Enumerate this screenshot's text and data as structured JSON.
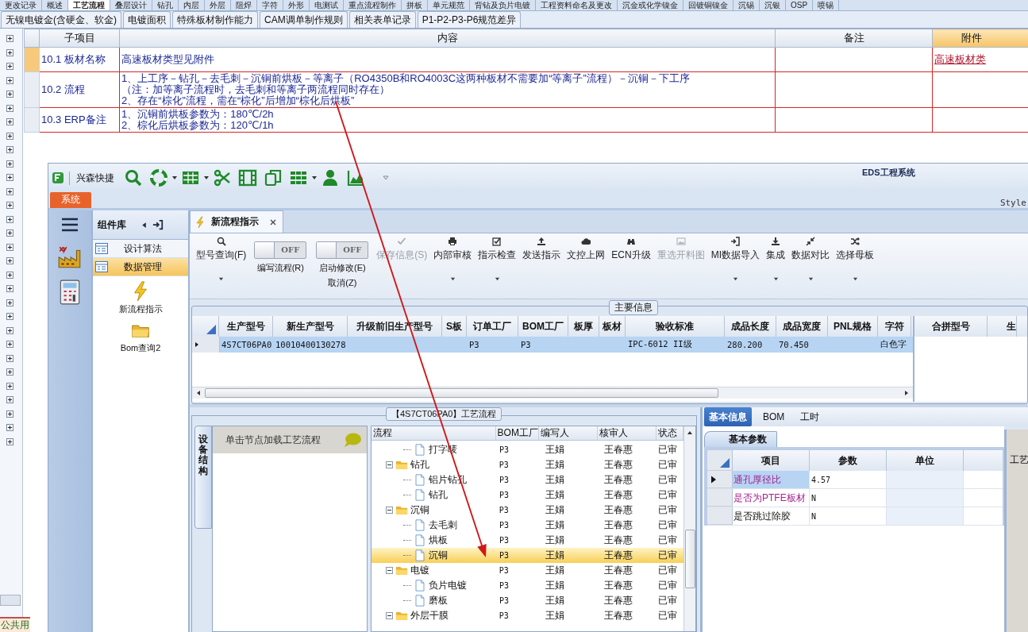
{
  "top_tabs": [
    {
      "label": "更改记录",
      "selected": false
    },
    {
      "label": "概述",
      "selected": false
    },
    {
      "label": "工艺流程",
      "selected": true
    },
    {
      "label": "叠层设计",
      "selected": false
    },
    {
      "label": "钻孔",
      "selected": false
    },
    {
      "label": "内层",
      "selected": false
    },
    {
      "label": "外层",
      "selected": false
    },
    {
      "label": "阻焊",
      "selected": false
    },
    {
      "label": "字符",
      "selected": false
    },
    {
      "label": "外形",
      "selected": false
    },
    {
      "label": "电测试",
      "selected": false
    },
    {
      "label": "重点流程制作",
      "selected": false
    },
    {
      "label": "拼板",
      "selected": false
    },
    {
      "label": "单元规范",
      "selected": false
    },
    {
      "label": "背钻及负片电镀",
      "selected": false
    },
    {
      "label": "工程资料命名及更改",
      "selected": false
    },
    {
      "label": "沉金或化学镍金",
      "selected": false
    },
    {
      "label": "回镀铜镍金",
      "selected": false
    },
    {
      "label": "沉锡",
      "selected": false
    },
    {
      "label": "沉银",
      "selected": false
    },
    {
      "label": "OSP",
      "selected": false
    },
    {
      "label": "喷锡",
      "selected": false
    }
  ],
  "sub_tabs": [
    {
      "label": "无镍电镀金(含硬金、软金)",
      "selected": false
    },
    {
      "label": "电镀面积",
      "selected": false
    },
    {
      "label": "特殊板材制作能力",
      "selected": false
    },
    {
      "label": "CAM调单制作规则",
      "selected": false
    },
    {
      "label": "相关表单记录",
      "selected": false
    },
    {
      "label": "P1-P2-P3-P6规范差异",
      "selected": false
    }
  ],
  "row_toggles": [
    {
      "expanded": false
    },
    {
      "expanded": false
    },
    {
      "expanded": false
    },
    {
      "expanded": false
    },
    {
      "expanded": false
    },
    {
      "expanded": false
    },
    {
      "expanded": false
    },
    {
      "expanded": false
    },
    {
      "expanded": false
    },
    {
      "expanded": false
    },
    {
      "expanded": false
    },
    {
      "expanded": false
    },
    {
      "expanded": false
    },
    {
      "expanded": false
    },
    {
      "expanded": false
    },
    {
      "expanded": false
    },
    {
      "expanded": false
    },
    {
      "expanded": false
    },
    {
      "expanded": false
    },
    {
      "expanded": false
    },
    {
      "expanded": false
    },
    {
      "expanded": false
    },
    {
      "expanded": false
    },
    {
      "expanded": false
    },
    {
      "expanded": false
    },
    {
      "expanded": false
    },
    {
      "expanded": false
    },
    {
      "expanded": false
    },
    {
      "expanded": false
    },
    {
      "expanded": false
    }
  ],
  "spec_table": {
    "columns": [
      "子项目",
      "内容",
      "备注",
      "附件"
    ],
    "rows": [
      {
        "item": "10.1 板材名称",
        "content": [
          "高速板材类型见附件"
        ],
        "attachment": "高速板材类",
        "selected": true
      },
      {
        "item": "10.2 流程",
        "content": [
          "1、上工序－钻孔－去毛刺－沉铜前烘板－等离子（RO4350B和RO4003C这两种板材不需要加“等离子”流程）－沉铜－下工序",
          "（注：加等离子流程时，去毛刺和等离子两流程同时存在）",
          "2、存在“棕化”流程，需在“棕化”后增加“棕化后烘板”"
        ],
        "selected": false
      },
      {
        "item": "10.3 ERP备注",
        "content": [
          "1、沉铜前烘板参数为：180℃/2h",
          "2、棕化后烘板参数为：120℃/1h"
        ],
        "selected": false
      }
    ]
  },
  "footer_tab": "公共用",
  "app": {
    "brand": "兴森快捷",
    "title": "EDS工程系统",
    "style_label": "Style",
    "ribbon_tab": "系统",
    "library": {
      "title": "组件库",
      "items": [
        {
          "label": "设计算法",
          "selected": false
        },
        {
          "label": "数据管理",
          "selected": true
        }
      ],
      "launchers": [
        {
          "label": "新流程指示",
          "kind": "lightning"
        },
        {
          "label": "Bom查询2",
          "kind": "folder"
        }
      ]
    },
    "doc_tabs": [
      {
        "label": "新流程指示",
        "selected": true
      }
    ],
    "toolbar": [
      {
        "kind": "button",
        "label": "型号查询(F)",
        "dropdown": true,
        "disabled": false
      },
      {
        "kind": "toggle",
        "label": "编写流程(R)",
        "switch_text": "OFF",
        "on": false
      },
      {
        "kind": "toggle",
        "label": "启动修改(E)",
        "sublabel": "取消(Z)",
        "switch_text": "OFF",
        "on": false
      },
      {
        "kind": "button",
        "label": "保存信息(S)",
        "dropdown": false,
        "disabled": true
      },
      {
        "kind": "button",
        "label": "内部审核",
        "dropdown": true,
        "disabled": false
      },
      {
        "kind": "button",
        "label": "指示检查",
        "dropdown": true,
        "disabled": false
      },
      {
        "kind": "button",
        "label": "发送指示",
        "dropdown": false,
        "disabled": false
      },
      {
        "kind": "button",
        "label": "文控上网",
        "dropdown": false,
        "disabled": false
      },
      {
        "kind": "button",
        "label": "ECN升级",
        "dropdown": false,
        "disabled": false
      },
      {
        "kind": "button",
        "label": "重选开料图",
        "dropdown": false,
        "disabled": true
      },
      {
        "kind": "button",
        "label": "MI数据导入",
        "dropdown": true,
        "disabled": false
      },
      {
        "kind": "button",
        "label": "集成",
        "dropdown": true,
        "disabled": false
      },
      {
        "kind": "button",
        "label": "数据对比",
        "dropdown": true,
        "disabled": false
      },
      {
        "kind": "button",
        "label": "选择母板",
        "dropdown": true,
        "disabled": false
      }
    ],
    "main_info": {
      "caption": "主要信息",
      "columns": [
        "生产型号",
        "新生产型号",
        "升级前旧生产型号",
        "S板",
        "订单工厂",
        "BOM工厂",
        "板厚",
        "板材",
        "验收标准",
        "成品长度",
        "成品宽度",
        "PNL规格",
        "字符"
      ],
      "rows": [
        {
          "cells": [
            "4S7CT06PA0",
            "10010400130278",
            null,
            null,
            "P3",
            "P3",
            null,
            null,
            "IPC-6012 II级",
            "280.200",
            "70.450",
            null,
            "白色字"
          ],
          "selected": true
        }
      ],
      "side_columns": [
        "合拼型号",
        "生"
      ]
    },
    "process": {
      "caption": "【4S7CT06PA0】工艺流程",
      "side_tab": "设备结构",
      "hint": "单击节点加载工艺流程",
      "columns": [
        "流程",
        "BOM工厂",
        "编写人",
        "核审人",
        "状态"
      ],
      "tree": [
        {
          "kind": "continued",
          "children": [
            {
              "kind": "file",
              "name": "打字唛",
              "factory": "P3",
              "author": "王娟",
              "reviewer": "王春惠",
              "status": "已审",
              "selected": false
            }
          ]
        },
        {
          "kind": "folder",
          "name": "钻孔",
          "factory": "P3",
          "author": "王娟",
          "reviewer": "王春惠",
          "status": "已审",
          "selected": false,
          "expanded": true,
          "children": [
            {
              "kind": "file",
              "name": "铝片钻孔",
              "factory": "P3",
              "author": "王娟",
              "reviewer": "王春惠",
              "status": "已审",
              "selected": false
            },
            {
              "kind": "file",
              "name": "钻孔",
              "factory": "P3",
              "author": "王娟",
              "reviewer": "王春惠",
              "status": "已审",
              "selected": false
            }
          ]
        },
        {
          "kind": "folder",
          "name": "沉铜",
          "factory": "P3",
          "author": "王娟",
          "reviewer": "王春惠",
          "status": "已审",
          "selected": false,
          "expanded": true,
          "children": [
            {
              "kind": "file",
              "name": "去毛刺",
              "factory": "P3",
              "author": "王娟",
              "reviewer": "王春惠",
              "status": "已审",
              "selected": false
            },
            {
              "kind": "file",
              "name": "烘板",
              "factory": "P3",
              "author": "王娟",
              "reviewer": "王春惠",
              "status": "已审",
              "selected": false
            },
            {
              "kind": "file",
              "name": "沉铜",
              "factory": "P3",
              "author": "王娟",
              "reviewer": "王春惠",
              "status": "已审",
              "selected": true
            }
          ]
        },
        {
          "kind": "folder",
          "name": "电镀",
          "factory": "P3",
          "author": "王娟",
          "reviewer": "王春惠",
          "status": "已审",
          "selected": false,
          "expanded": true,
          "children": [
            {
              "kind": "file",
              "name": "负片电镀",
              "factory": "P3",
              "author": "王娟",
              "reviewer": "王春惠",
              "status": "已审",
              "selected": false
            },
            {
              "kind": "file",
              "name": "磨板",
              "factory": "P3",
              "author": "王娟",
              "reviewer": "王春惠",
              "status": "已审",
              "selected": false
            }
          ]
        },
        {
          "kind": "folder",
          "name": "外层干膜",
          "factory": "P3",
          "author": "王娟",
          "reviewer": "王春惠",
          "status": "已审",
          "selected": false,
          "expanded": true
        }
      ]
    },
    "detail": {
      "tabs": [
        {
          "label": "基本信息",
          "selected": true
        },
        {
          "label": "BOM",
          "selected": false
        },
        {
          "label": "工时",
          "selected": false
        }
      ],
      "subtab": "基本参数",
      "columns": [
        "项目",
        "参数",
        "单位"
      ],
      "rows": [
        {
          "item": "通孔厚径比",
          "value": "4.57",
          "emphasized": true,
          "selected": true
        },
        {
          "item": "是否为PTFE板材",
          "value": "N",
          "emphasized": true,
          "selected": false
        },
        {
          "item": "是否跳过除胶",
          "value": "N",
          "emphasized": false,
          "selected": false
        }
      ],
      "side_panel_label": "工艺"
    }
  }
}
